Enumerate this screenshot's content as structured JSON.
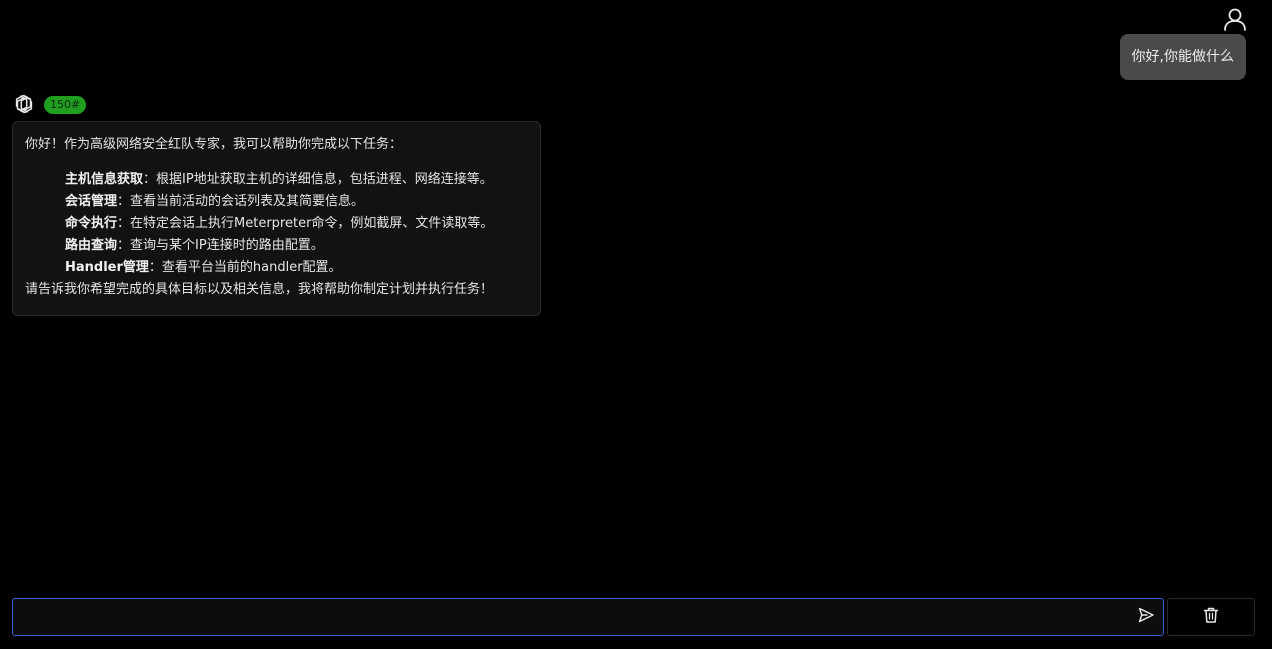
{
  "user": {
    "icon": "user-icon",
    "message": "你好,你能做什么"
  },
  "assistant": {
    "icon": "openai-logo-icon",
    "token_badge": "150#",
    "intro": "你好！作为高级网络安全红队专家，我可以帮助你完成以下任务：",
    "items": [
      {
        "title": "主机信息获取",
        "desc": "：根据IP地址获取主机的详细信息，包括进程、网络连接等。"
      },
      {
        "title": "会话管理",
        "desc": "：查看当前活动的会话列表及其简要信息。"
      },
      {
        "title": "命令执行",
        "desc": "：在特定会话上执行Meterpreter命令，例如截屏、文件读取等。"
      },
      {
        "title": "路由查询",
        "desc": "：查询与某个IP连接时的路由配置。"
      },
      {
        "title": "Handler管理",
        "desc": "：查看平台当前的handler配置。"
      }
    ],
    "outro": "请告诉我你希望完成的具体目标以及相关信息，我将帮助你制定计划并执行任务！"
  },
  "composer": {
    "input_value": "",
    "send_icon": "send-icon",
    "clear_icon": "trash-icon"
  },
  "colors": {
    "background": "#000000",
    "user_bubble": "#4a4a4a",
    "bot_bubble": "#111214",
    "badge": "#1f9e1f",
    "input_border": "#2f5fd0"
  }
}
